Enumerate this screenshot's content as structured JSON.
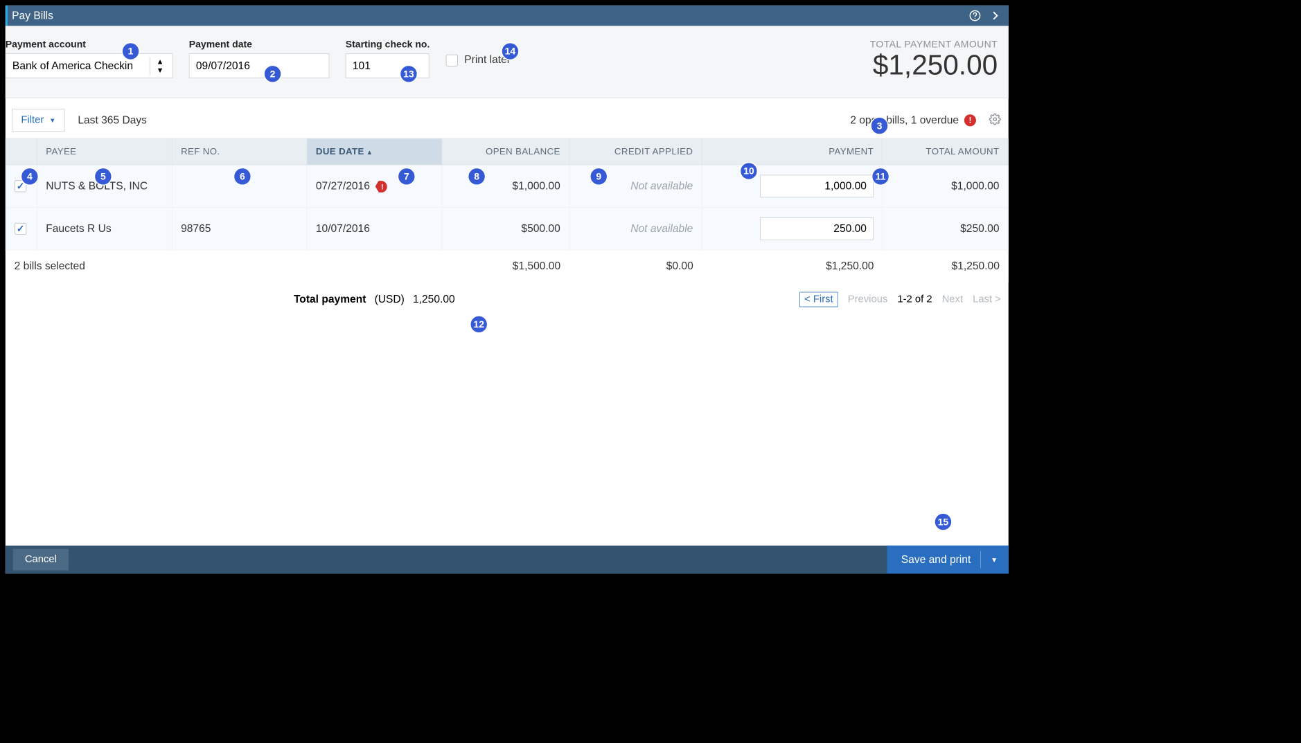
{
  "window": {
    "title": "Pay Bills"
  },
  "form": {
    "payment_account_label": "Payment account",
    "payment_account_value": "Bank of America Checkin",
    "payment_date_label": "Payment date",
    "payment_date_value": "09/07/2016",
    "starting_check_label": "Starting check no.",
    "starting_check_value": "101",
    "print_later_label": "Print later",
    "print_later_checked": false
  },
  "totals_header": {
    "label": "TOTAL PAYMENT AMOUNT",
    "amount": "$1,250.00"
  },
  "toolbar": {
    "filter_label": "Filter",
    "filter_range": "Last 365 Days",
    "open_bills_text": "2 open bills, 1 overdue"
  },
  "columns": {
    "payee": "PAYEE",
    "refno": "REF NO.",
    "duedate": "DUE DATE",
    "openbal": "OPEN BALANCE",
    "credit": "CREDIT APPLIED",
    "payment": "PAYMENT",
    "totalamt": "TOTAL AMOUNT"
  },
  "rows": [
    {
      "checked": true,
      "payee": "NUTS & BOLTS, INC",
      "refno": "",
      "duedate": "07/27/2016",
      "overdue": true,
      "openbal": "$1,000.00",
      "credit": "Not available",
      "payment": "1,000.00",
      "totalamt": "$1,000.00"
    },
    {
      "checked": true,
      "payee": "Faucets R Us",
      "refno": "98765",
      "duedate": "10/07/2016",
      "overdue": false,
      "openbal": "$500.00",
      "credit": "Not available",
      "payment": "250.00",
      "totalamt": "$250.00"
    }
  ],
  "totals_row": {
    "lead": "2 bills selected",
    "openbal": "$1,500.00",
    "credit": "$0.00",
    "payment": "$1,250.00",
    "totalamt": "$1,250.00"
  },
  "footer": {
    "total_payment_label": "Total payment",
    "currency": "(USD)",
    "total_payment_value": "1,250.00",
    "pager": {
      "first": "< First",
      "prev": "Previous",
      "range": "1-2 of 2",
      "next": "Next",
      "last": "Last >"
    }
  },
  "bottom": {
    "cancel": "Cancel",
    "save": "Save and print"
  },
  "annotations": [
    "1",
    "2",
    "3",
    "4",
    "5",
    "6",
    "7",
    "8",
    "9",
    "10",
    "11",
    "12",
    "13",
    "14",
    "15"
  ]
}
